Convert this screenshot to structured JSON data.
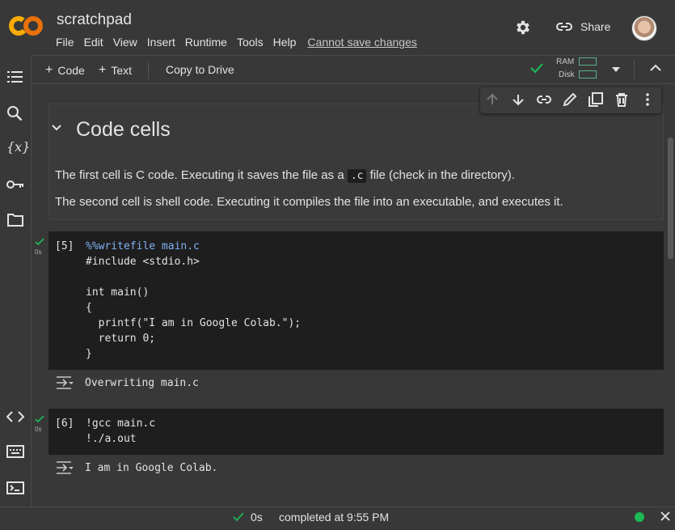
{
  "app": {
    "notebook_title": "scratchpad",
    "menu": [
      "File",
      "Edit",
      "View",
      "Insert",
      "Runtime",
      "Tools",
      "Help"
    ],
    "save_warning": "Cannot save changes",
    "share_label": "Share"
  },
  "toolbar": {
    "add_code": "Code",
    "add_text": "Text",
    "copy_to_drive": "Copy to Drive",
    "ram_label": "RAM",
    "disk_label": "Disk"
  },
  "text_cell": {
    "heading": "Code cells",
    "para1_before": "The first cell is C code. Executing it saves the file as a",
    "para1_code": ".c",
    "para1_after": "file (check in the directory).",
    "para2": "The second cell is shell code. Executing it compiles the file into an executable, and executes it."
  },
  "code_cells": [
    {
      "exec_count": "[5]",
      "runtime": "0s",
      "magic": "%%writefile main.c",
      "lines": [
        "#include <stdio.h>",
        "",
        "int main()",
        "{",
        "  printf(\"I am in Google Colab.\");",
        "  return 0;",
        "}"
      ],
      "output": "Overwriting main.c"
    },
    {
      "exec_count": "[6]",
      "runtime": "0s",
      "lines": [
        "!gcc main.c",
        "!./a.out"
      ],
      "output": "I am in Google Colab."
    }
  ],
  "status": {
    "elapsed": "0s",
    "completed_text": "completed at 9:55 PM"
  },
  "colors": {
    "accent_check": "#1db954",
    "logo_orange": "#f9ab00",
    "magic_blue": "#7fb0f5",
    "background": "#383838",
    "code_bg": "#1e1e1e"
  },
  "icons": {
    "sidebar": [
      "toc-icon",
      "search-icon",
      "variables-icon",
      "key-icon",
      "folder-icon",
      "code-snippets-icon",
      "command-palette-icon",
      "terminal-icon"
    ],
    "cell_toolbar": [
      "arrow-up-icon",
      "arrow-down-icon",
      "link-icon",
      "pencil-icon",
      "mirror-cell-icon",
      "trash-icon",
      "more-vert-icon"
    ]
  }
}
